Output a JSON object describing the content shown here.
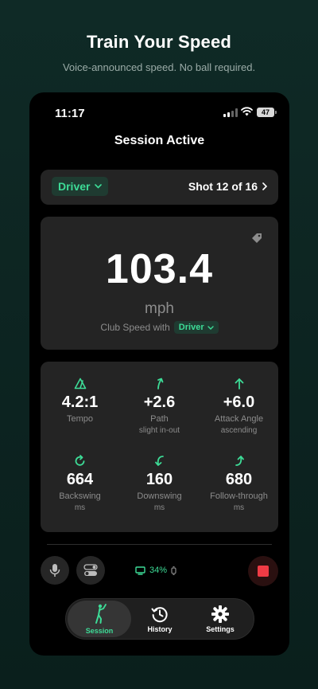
{
  "hero": {
    "title": "Train Your Speed",
    "subtitle": "Voice-announced speed. No ball required."
  },
  "status_bar": {
    "time": "11:17",
    "battery": "47"
  },
  "screen": {
    "title": "Session Active"
  },
  "shot_bar": {
    "club": "Driver",
    "shot_counter": "Shot 12 of 16"
  },
  "speed": {
    "value": "103.4",
    "unit": "mph",
    "caption": "Club Speed with",
    "club": "Driver"
  },
  "metrics": [
    {
      "icon": "tempo-triangle-icon",
      "value": "4.2:1",
      "label": "Tempo",
      "sub": ""
    },
    {
      "icon": "arrow-up-right-icon",
      "value": "+2.6",
      "label": "Path",
      "sub": "slight in-out"
    },
    {
      "icon": "arrow-up-icon",
      "value": "+6.0",
      "label": "Attack Angle",
      "sub": "ascending"
    },
    {
      "icon": "rotate-clockwise-icon",
      "value": "664",
      "label": "Backswing",
      "sub": "ms"
    },
    {
      "icon": "curved-down-arrow-icon",
      "value": "160",
      "label": "Downswing",
      "sub": "ms"
    },
    {
      "icon": "curved-up-arrow-icon",
      "value": "680",
      "label": "Follow-through",
      "sub": "ms"
    }
  ],
  "controls": {
    "device_battery": "34%"
  },
  "tabs": [
    {
      "label": "Session",
      "icon": "golfer-icon",
      "active": true
    },
    {
      "label": "History",
      "icon": "history-clock-icon",
      "active": false
    },
    {
      "label": "Settings",
      "icon": "gear-icon",
      "active": false
    }
  ],
  "colors": {
    "accent": "#3ddc97",
    "background": "#0f2a26",
    "card": "#242424",
    "stop": "#ef3b45"
  }
}
